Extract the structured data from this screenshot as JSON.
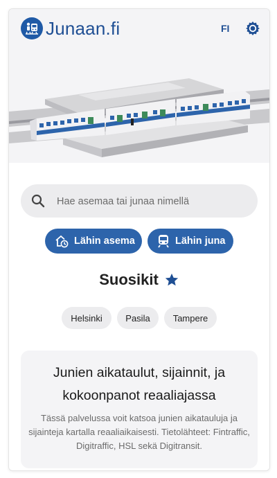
{
  "header": {
    "app_name": "Junaan.fi",
    "language": "FI",
    "brand_color": "#1f4f94"
  },
  "icons": {
    "logo": "train-logo-icon",
    "settings": "gear-icon",
    "search": "search-icon",
    "nearest_station": "station-clock-icon",
    "nearest_train": "train-icon",
    "favorites": "star-icon"
  },
  "search": {
    "placeholder": "Hae asemaa tai junaa nimellä"
  },
  "actions": {
    "nearest_station": "Lähin asema",
    "nearest_train": "Lähin juna",
    "button_color": "#2d64ab"
  },
  "favorites": {
    "title": "Suosikit",
    "stations": [
      "Helsinki",
      "Pasila",
      "Tampere"
    ]
  },
  "info": {
    "title": "Junien aikataulut, sijainnit, ja kokoonpanot reaaliajassa",
    "body": "Tässä palvelussa voit katsoa junien aikatauluja ja sijainteja kartalla reaaliaikaisesti. Tietolähteet: Fintraffic, Digitraffic, HSL sekä Digitransit."
  }
}
